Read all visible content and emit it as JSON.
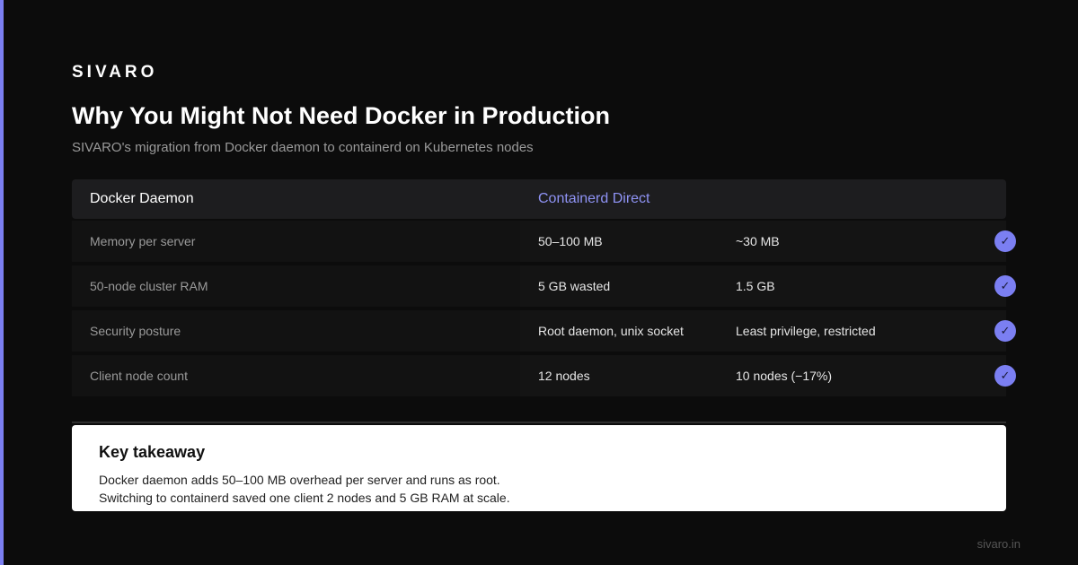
{
  "brand": "SIVARO",
  "title": "Why You Might Not Need Docker in Production",
  "subtitle": "SIVARO's migration from Docker daemon to containerd on Kubernetes nodes",
  "table": {
    "header_left": "Docker Daemon",
    "header_right": "Containerd Direct",
    "rows": [
      {
        "label": "Memory per server",
        "docker": "50–100 MB",
        "containerd": "~30 MB"
      },
      {
        "label": "50-node cluster RAM",
        "docker": "5 GB wasted",
        "containerd": "1.5 GB"
      },
      {
        "label": "Security posture",
        "docker": "Root daemon, unix socket",
        "containerd": "Least privilege, restricted"
      },
      {
        "label": "Client node count",
        "docker": "12 nodes",
        "containerd": "10 nodes (−17%)"
      }
    ],
    "check_glyph": "✓"
  },
  "takeaway": {
    "title": "Key takeaway",
    "line1": "Docker daemon adds 50–100 MB overhead per server and runs as root.",
    "line2": "Switching to containerd saved one client 2 nodes and 5 GB RAM at scale."
  },
  "footer": "sivaro.in",
  "colors": {
    "accent": "#7b7ff2",
    "background": "#0c0c0c"
  }
}
